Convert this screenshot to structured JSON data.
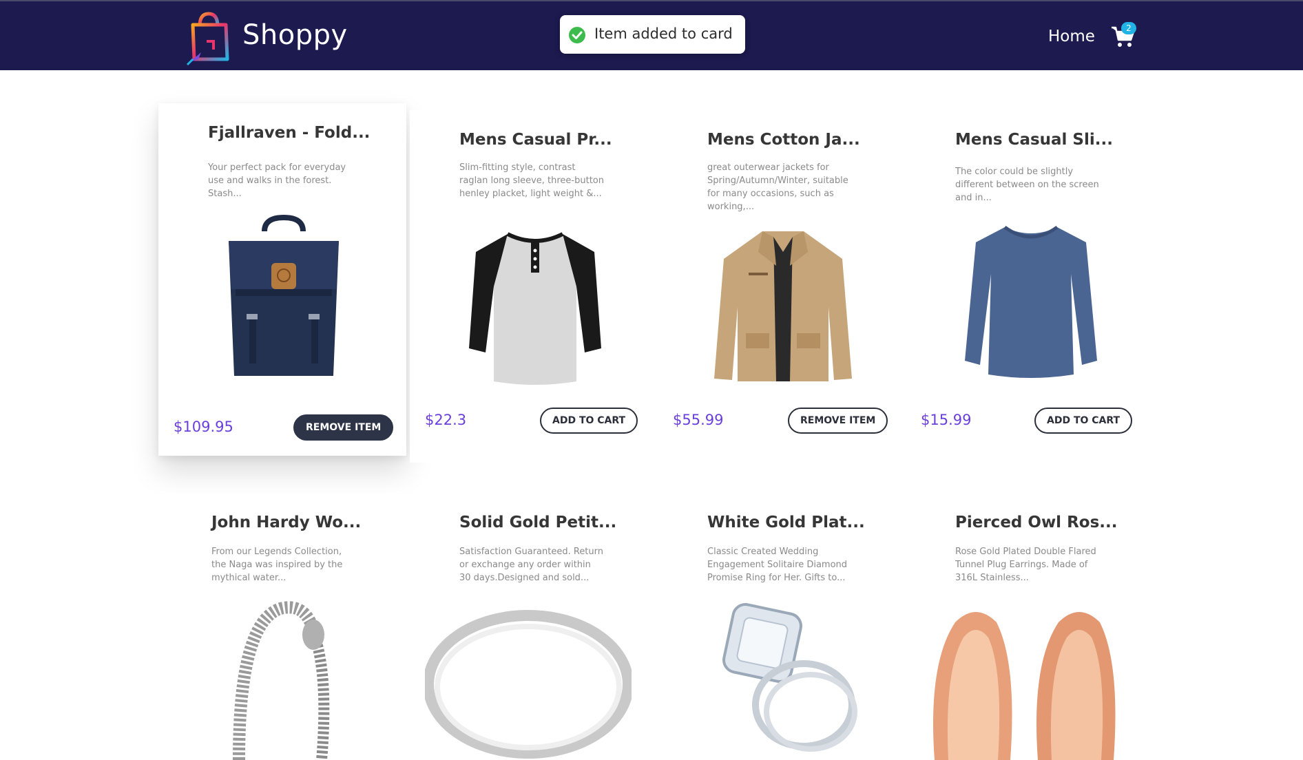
{
  "header": {
    "brand": "Shoppy",
    "nav_home": "Home",
    "cart_count": "2",
    "bg_color": "#1c1a4e"
  },
  "toast": {
    "message": "Item added to card",
    "icon": "check-circle-icon",
    "color": "#3dbb4c"
  },
  "products": [
    {
      "title": "Fjallraven - Fold...",
      "description": "Your perfect pack for everyday use and walks in the forest. Stash...",
      "price": "$109.95",
      "button": "REMOVE ITEM",
      "image": "backpack-image"
    },
    {
      "title": "Mens Casual Pr...",
      "description": "Slim-fitting style, contrast raglan long sleeve, three-button henley placket, light weight &...",
      "price": "$22.3",
      "button": "ADD TO CART",
      "image": "henley-shirt-image"
    },
    {
      "title": "Mens Cotton Ja...",
      "description": "great outerwear jackets for Spring/Autumn/Winter, suitable for many occasions, such as working,...",
      "price": "$55.99",
      "button": "REMOVE ITEM",
      "image": "cotton-jacket-image"
    },
    {
      "title": "Mens Casual Sli...",
      "description": "The color could be slightly different between on the screen and in...",
      "price": "$15.99",
      "button": "ADD TO CART",
      "image": "long-sleeve-shirt-image"
    },
    {
      "title": "John Hardy Wo...",
      "description": "From our Legends Collection, the Naga was inspired by the mythical water...",
      "image": "dragon-bracelet-image"
    },
    {
      "title": "Solid Gold Petit...",
      "description": "Satisfaction Guaranteed. Return or exchange any order within 30 days.Designed and sold...",
      "image": "silver-ring-image"
    },
    {
      "title": "White Gold Plat...",
      "description": "Classic Created Wedding Engagement Solitaire Diamond Promise Ring for Her. Gifts to...",
      "image": "diamond-ring-image"
    },
    {
      "title": "Pierced Owl Ros...",
      "description": "Rose Gold Plated Double Flared Tunnel Plug Earrings. Made of 316L Stainless...",
      "image": "rose-gold-plugs-image"
    }
  ],
  "colors": {
    "price": "#6a3fdc",
    "button_dark": "#2d3447",
    "accent_badge": "#22b3e6"
  }
}
